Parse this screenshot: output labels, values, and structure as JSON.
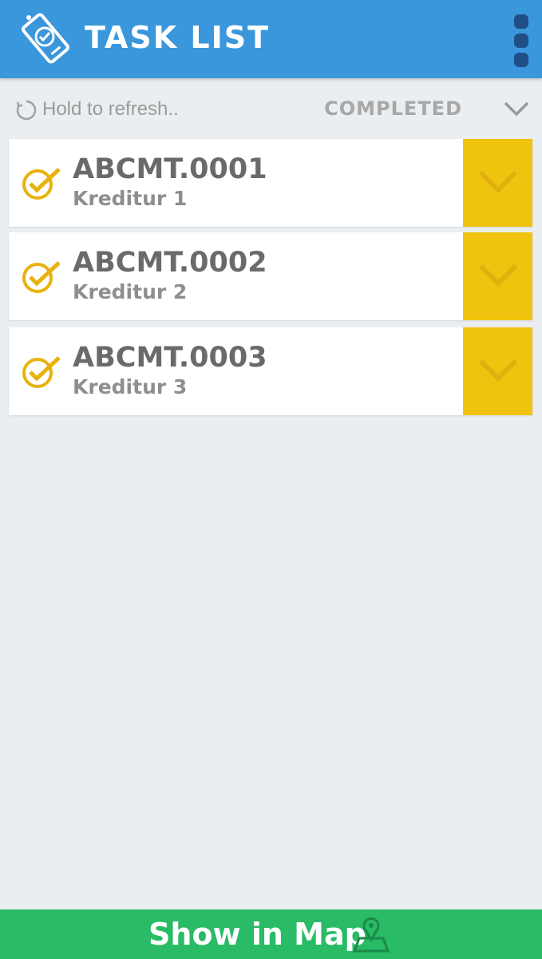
{
  "app_bar": {
    "title": "TASK LIST",
    "logo_icon": "phone-tag-check-icon",
    "menu_icon": "overflow-menu-icon"
  },
  "toolbar": {
    "refresh_label": "Hold to refresh..",
    "filter_label": "COMPLETED"
  },
  "tasks": [
    {
      "code": "ABCMT.0001",
      "creditor": "Kreditur 1"
    },
    {
      "code": "ABCMT.0002",
      "creditor": "Kreditur 2"
    },
    {
      "code": "ABCMT.0003",
      "creditor": "Kreditur 3"
    }
  ],
  "bottom_bar": {
    "label": "Show in Map"
  },
  "colors": {
    "app_bar": "#3a97dc",
    "accent_yellow": "#f0c30f",
    "map_green": "#29bb65",
    "background": "#ebeef0"
  }
}
